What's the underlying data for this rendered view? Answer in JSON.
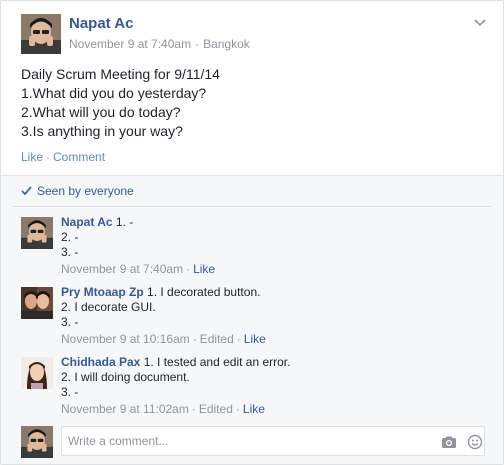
{
  "post": {
    "author": "Napat Ac",
    "date": "November 9 at 7:40am",
    "location_separator": "·",
    "location": "Bangkok",
    "lines": [
      "Daily Scrum Meeting for 9/11/14",
      "1.What did you do yesterday?",
      "2.What will you do today?",
      "3.Is anything in your way?"
    ],
    "like_label": "Like",
    "comment_label": "Comment",
    "action_separator": "·"
  },
  "seen_by": "Seen by everyone",
  "comments": [
    {
      "author": "Napat Ac",
      "lines": [
        "1. -",
        "2. -",
        "3. -"
      ],
      "date": "November 9 at 7:40am",
      "edited": "",
      "like": "Like"
    },
    {
      "author": "Pry Mtoaap Zp",
      "lines": [
        "1. I decorated button.",
        "2. I decorate GUI.",
        "3. -"
      ],
      "date": "November 9 at 10:16am",
      "edited": "Edited",
      "like": "Like"
    },
    {
      "author": "Chidhada Pax",
      "lines": [
        "1. I tested and edit an error.",
        "2. I will doing document.",
        "3. -"
      ],
      "date": "November 9 at 11:02am",
      "edited": "Edited",
      "like": "Like"
    }
  ],
  "composer": {
    "placeholder": "Write a comment..."
  },
  "colors": {
    "link": "#365899",
    "meta": "#90949c",
    "text": "#1d2129",
    "feedback_bg": "#f6f7f9"
  }
}
